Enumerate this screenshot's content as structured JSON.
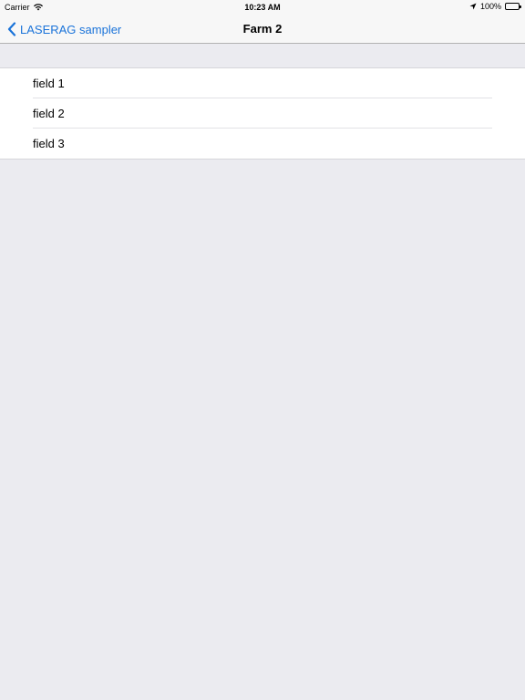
{
  "status_bar": {
    "carrier": "Carrier",
    "time": "10:23 AM",
    "battery": "100%",
    "icons": [
      "wifi-icon",
      "location-icon",
      "battery-icon"
    ]
  },
  "nav_bar": {
    "back_label": "LASERAG sampler",
    "title": "Farm 2"
  },
  "list": {
    "items": [
      {
        "label": "field 1"
      },
      {
        "label": "field 2"
      },
      {
        "label": "field 3"
      }
    ]
  },
  "colors": {
    "accent": "#1a73d9",
    "background": "#ebebf0",
    "bar": "#f7f7f7"
  }
}
